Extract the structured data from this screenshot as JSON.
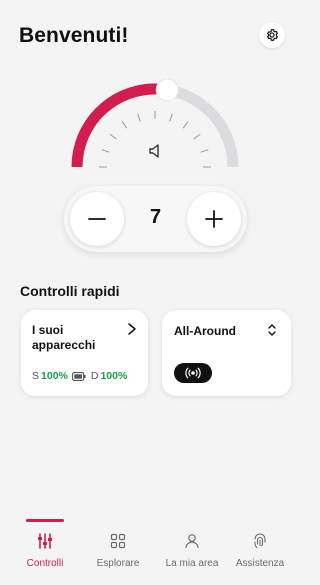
{
  "header": {
    "title": "Benvenuti!",
    "settings_icon": "gear-icon"
  },
  "volume": {
    "value": "7",
    "level_fraction": 0.55,
    "accent_color": "#d21e4c",
    "minus_label": "−",
    "plus_label": "+",
    "speaker_icon": "speaker-icon"
  },
  "quick_controls": {
    "title": "Controlli rapidi",
    "devices_card": {
      "label": "I suoi apparecchi",
      "left_side": "S",
      "left_pct": "100%",
      "right_side": "D",
      "right_pct": "100%",
      "battery_color": "#1e9e4a"
    },
    "program_card": {
      "label": "All-Around",
      "program_icon": "surround-sound-icon"
    }
  },
  "nav": {
    "items": [
      {
        "label": "Controlli",
        "icon": "sliders-icon",
        "active": true
      },
      {
        "label": "Esplorare",
        "icon": "grid-icon",
        "active": false
      },
      {
        "label": "La mia area",
        "icon": "user-icon",
        "active": false
      },
      {
        "label": "Assistenza",
        "icon": "fingerprint-icon",
        "active": false
      }
    ]
  }
}
